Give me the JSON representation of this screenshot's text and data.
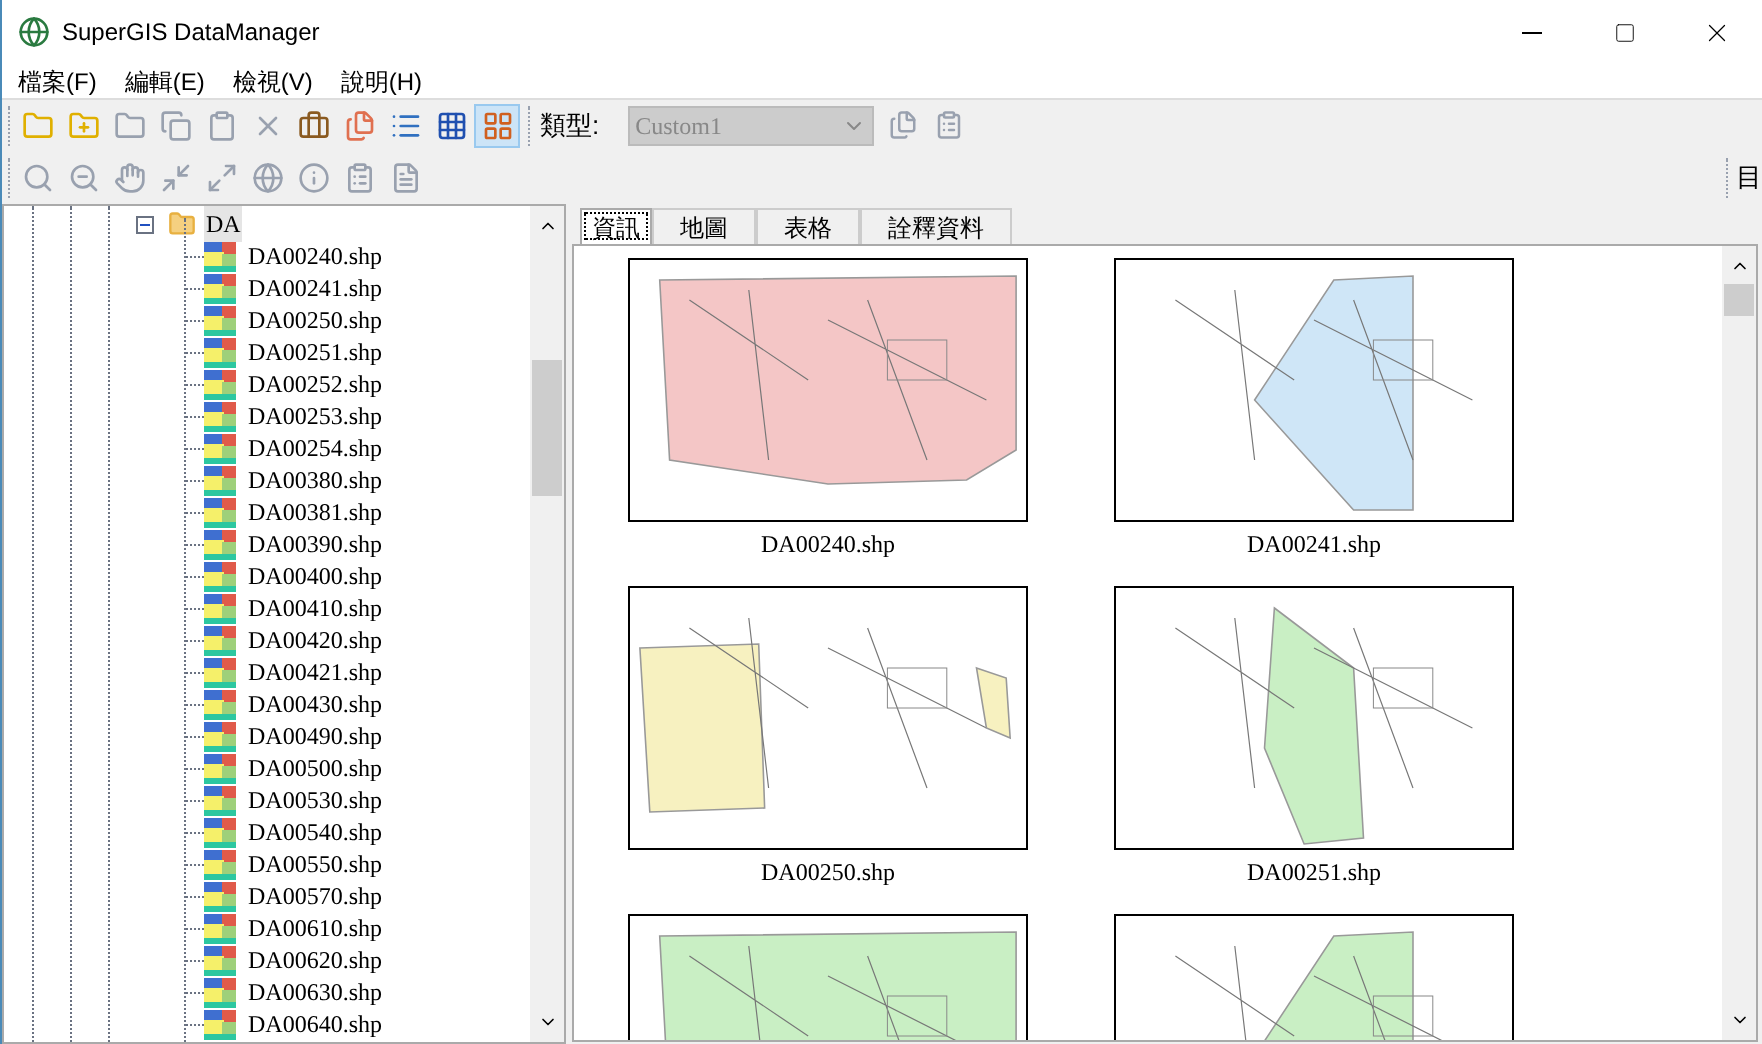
{
  "window": {
    "title": "SuperGIS DataManager"
  },
  "menu": [
    "檔案(F)",
    "編輯(E)",
    "檢視(V)",
    "說明(H)"
  ],
  "type_selector": {
    "label": "類型:",
    "value": "Custom1",
    "disabled": true
  },
  "side_toolbar_label": "目",
  "tree": {
    "label": "DA",
    "expanded": true,
    "selected": true,
    "children": [
      {
        "label": "DA00240.shp",
        "selected": false
      },
      {
        "label": "DA00241.shp",
        "selected": false
      },
      {
        "label": "DA00250.shp",
        "selected": false
      },
      {
        "label": "DA00251.shp",
        "selected": false
      },
      {
        "label": "DA00252.shp",
        "selected": false
      },
      {
        "label": "DA00253.shp",
        "selected": false
      },
      {
        "label": "DA00254.shp",
        "selected": false
      },
      {
        "label": "DA00380.shp",
        "selected": false
      },
      {
        "label": "DA00381.shp",
        "selected": false
      },
      {
        "label": "DA00390.shp",
        "selected": false
      },
      {
        "label": "DA00400.shp",
        "selected": false
      },
      {
        "label": "DA00410.shp",
        "selected": false
      },
      {
        "label": "DA00420.shp",
        "selected": false
      },
      {
        "label": "DA00421.shp",
        "selected": false
      },
      {
        "label": "DA00430.shp",
        "selected": false
      },
      {
        "label": "DA00490.shp",
        "selected": false
      },
      {
        "label": "DA00500.shp",
        "selected": false
      },
      {
        "label": "DA00530.shp",
        "selected": false
      },
      {
        "label": "DA00540.shp",
        "selected": false
      },
      {
        "label": "DA00550.shp",
        "selected": false
      },
      {
        "label": "DA00570.shp",
        "selected": false
      },
      {
        "label": "DA00610.shp",
        "selected": false
      },
      {
        "label": "DA00620.shp",
        "selected": false
      },
      {
        "label": "DA00630.shp",
        "selected": false
      },
      {
        "label": "DA00640.shp",
        "selected": false
      }
    ]
  },
  "tabs": [
    {
      "label": "資訊",
      "selected": true
    },
    {
      "label": "地圖",
      "selected": false
    },
    {
      "label": "表格",
      "selected": false
    },
    {
      "label": "詮釋資料",
      "selected": false
    }
  ],
  "thumbnails": [
    {
      "label": "DA00240.shp",
      "color": "#f4c6c6"
    },
    {
      "label": "DA00241.shp",
      "color": "#cfe6f7"
    },
    {
      "label": "DA00250.shp",
      "color": "#f7f1c0"
    },
    {
      "label": "DA00251.shp",
      "color": "#c9efc4"
    },
    {
      "color": "#c9efc4"
    },
    {
      "color": "#c9efc4"
    }
  ]
}
